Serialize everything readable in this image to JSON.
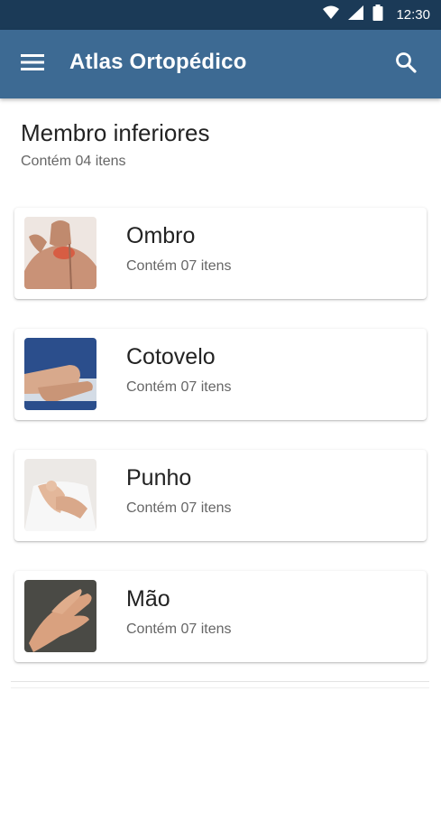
{
  "status_bar": {
    "time": "12:30",
    "icons": [
      "wifi-icon",
      "signal-icon",
      "battery-icon"
    ]
  },
  "app_bar": {
    "title": "Atlas Ortopédico",
    "menu_icon": "menu-icon",
    "search_icon": "search-icon",
    "background_color": "#3d6a93"
  },
  "section": {
    "title": "Membro inferiores",
    "subtitle": "Contém 04 itens"
  },
  "items": [
    {
      "title": "Ombro",
      "subtitle": "Contém 07 itens",
      "image": "shoulder-photo"
    },
    {
      "title": "Cotovelo",
      "subtitle": "Contém 07 itens",
      "image": "elbow-photo"
    },
    {
      "title": "Punho",
      "subtitle": "Contém 07 itens",
      "image": "wrist-photo"
    },
    {
      "title": "Mão",
      "subtitle": "Contém 07 itens",
      "image": "hand-photo"
    }
  ]
}
